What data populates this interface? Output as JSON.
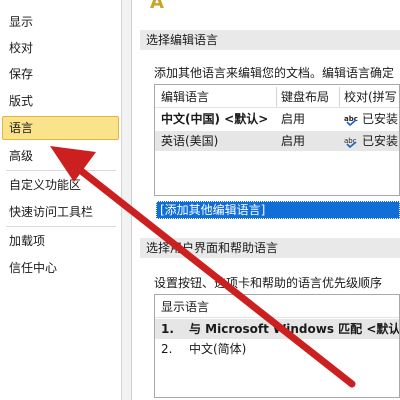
{
  "sidebar": {
    "items": [
      {
        "label": "显示"
      },
      {
        "label": "校对"
      },
      {
        "label": "保存"
      },
      {
        "label": "版式"
      },
      {
        "label": "语言"
      },
      {
        "label": "高级"
      },
      {
        "label": "自定义功能区"
      },
      {
        "label": "快速访问工具栏"
      },
      {
        "label": "加载项"
      },
      {
        "label": "信任中心"
      }
    ],
    "selected": "语言"
  },
  "main": {
    "editing_language": {
      "header": "选择编辑语言",
      "description": "添加其他语言来编辑您的文档。编辑语言确定",
      "columns": [
        "编辑语言",
        "键盘布局",
        "校对(拼写"
      ],
      "rows": [
        {
          "language": "中文(中国) <默认>",
          "keyboard": "启用",
          "proofing": "已安装"
        },
        {
          "language": "英语(美国)",
          "keyboard": "启用",
          "proofing": "已安装"
        }
      ],
      "add_dropdown": "[添加其他编辑语言]"
    },
    "ui_language": {
      "header": "选择用户界面和帮助语言",
      "description": "设置按钮、选项卡和帮助的语言优先级顺序",
      "column": "显示语言",
      "rows": [
        {
          "num": "1.",
          "language": "与 Microsoft Windows 匹配 <默认>"
        },
        {
          "num": "2.",
          "language": "中文(简体)"
        }
      ]
    }
  },
  "colors": {
    "selected_bg": "#fbe38b",
    "arrow": "#cc1f1f",
    "section_bg": "#e9e9e9",
    "link_bg": "#0f6fd6"
  }
}
